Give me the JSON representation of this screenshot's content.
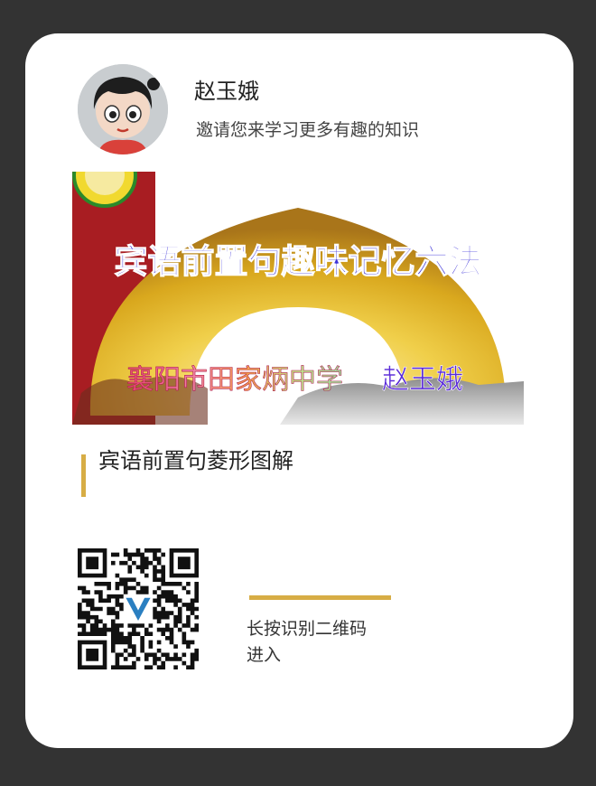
{
  "author": {
    "name": "赵玉娥",
    "invite_text": "邀请您来学习更多有趣的知识"
  },
  "banner": {
    "headline": "宾语前置句趣味记忆六法",
    "school": "襄阳市田家炳中学",
    "teacher": "赵玉娥"
  },
  "lesson": {
    "title": "宾语前置句菱形图解"
  },
  "qr": {
    "hint_line1": "长按识别二维码",
    "hint_line2": "进入"
  },
  "colors": {
    "background": "#333333",
    "card": "#ffffff",
    "accent": "#d7ad45"
  }
}
